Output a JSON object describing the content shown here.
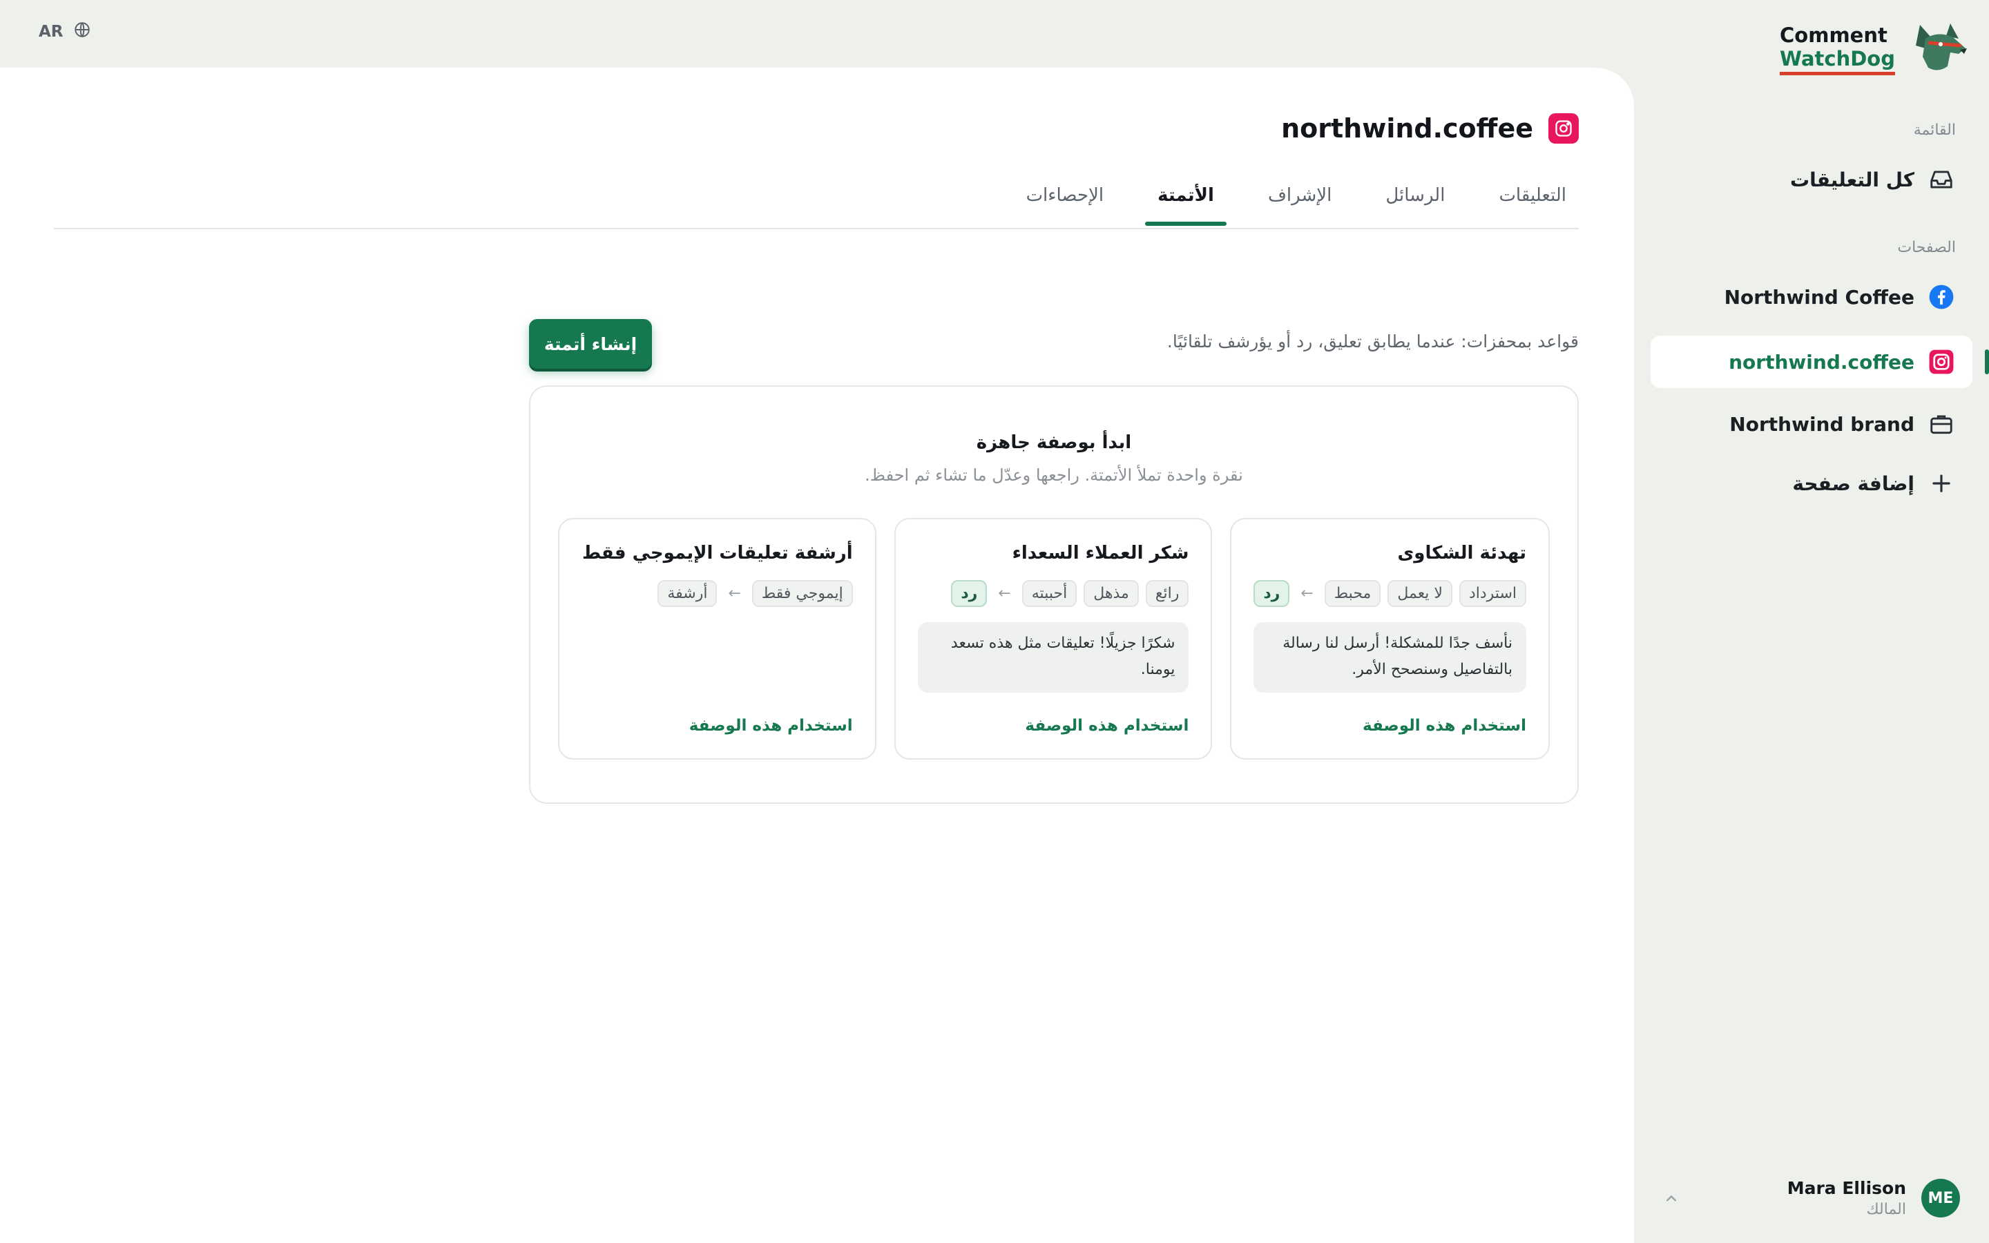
{
  "language": {
    "code": "AR",
    "icon": "globe-icon"
  },
  "brand": {
    "line1": "Comment",
    "line2": "WatchDog",
    "logo": "dog-logo-icon"
  },
  "sidebar": {
    "menu_label": "القائمة",
    "all_comments": "كل التعليقات",
    "pages_label": "الصفحات",
    "pages": [
      {
        "label": "Northwind Coffee",
        "icon": "facebook-icon"
      },
      {
        "label": "northwind.coffee",
        "icon": "instagram-icon",
        "active": true
      },
      {
        "label": "Northwind brand",
        "icon": "briefcase-icon"
      }
    ],
    "add_page": "إضافة صفحة"
  },
  "user": {
    "initials": "ME",
    "name": "Mara Ellison",
    "role": "المالك"
  },
  "page": {
    "title": "northwind.coffee",
    "tabs": [
      "التعليقات",
      "الرسائل",
      "الإشراف",
      "الأتمتة",
      "الإحصاءات"
    ],
    "active_tab": "الأتمتة",
    "description": "قواعد بمحفزات: عندما يطابق تعليق، رد أو يؤرشف تلقائيًا.",
    "create_button": "إنشاء أتمتة"
  },
  "recipes": {
    "title": "ابدأ بوصفة جاهزة",
    "subtitle": "نقرة واحدة تملأ الأتمتة. راجعها وعدّل ما تشاء ثم احفظ.",
    "use_label": "استخدام هذه الوصفة",
    "cards": [
      {
        "title": "تهدئة الشكاوى",
        "triggers": [
          "استرداد",
          "لا يعمل",
          "محبط"
        ],
        "action": "رد",
        "reply": "نأسف جدًا للمشكلة! أرسل لنا رسالة بالتفاصيل وسنصحح الأمر."
      },
      {
        "title": "شكر العملاء السعداء",
        "triggers": [
          "رائع",
          "مذهل",
          "أحببته"
        ],
        "action": "رد",
        "reply": "شكرًا جزيلًا! تعليقات مثل هذه تسعد يومنا."
      },
      {
        "title": "أرشفة تعليقات الإيموجي فقط",
        "triggers": [
          "إيموجي فقط"
        ],
        "action": "أرشفة",
        "reply": ""
      }
    ]
  },
  "colors": {
    "accent": "#16784f",
    "instagram": "#e8175d",
    "facebook": "#1877f2",
    "brand_underline": "#d8402b"
  }
}
